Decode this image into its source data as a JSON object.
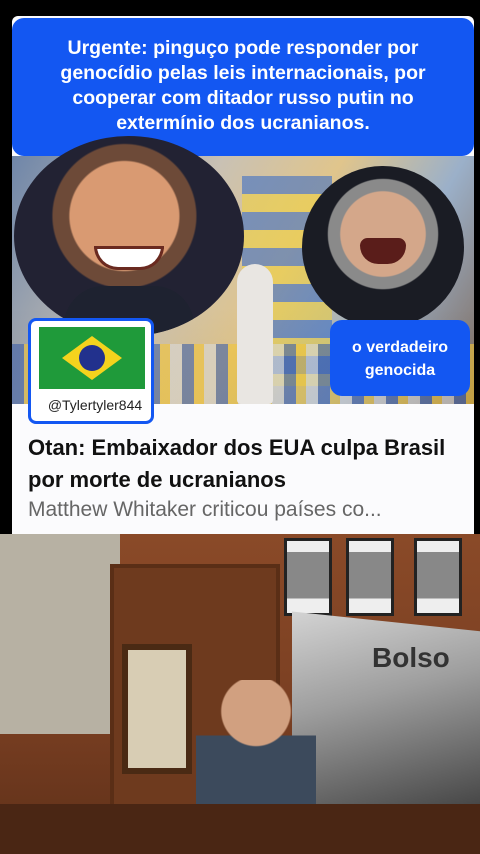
{
  "headline": "Urgente: pinguço pode responder por genocídio pelas leis internacionais, por cooperar com ditador russo putin no extermínio dos ucranianos.",
  "label_right": "o verdadeiro genocida",
  "handle": "@Tylertyler844",
  "article": {
    "title": "Otan: Embaixador dos EUA culpa Brasil por morte de ucranianos",
    "subtitle": "Matthew Whitaker criticou países co..."
  },
  "banner_text": "Bolso"
}
